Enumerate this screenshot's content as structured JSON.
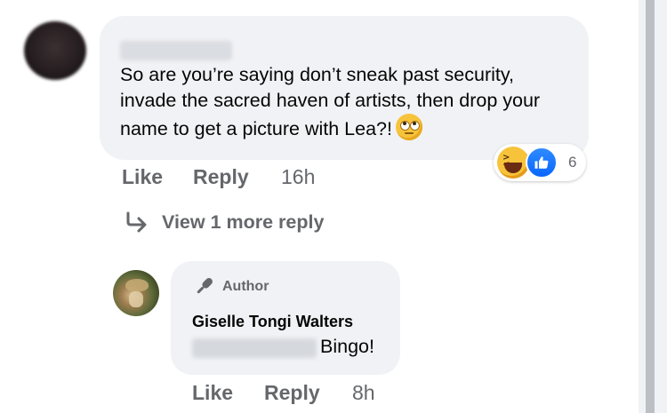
{
  "comment": {
    "author_name": "",
    "text": "So are you’re saying don’t sneak past security, invade the sacred haven of artists, then drop your name to get a picture with Lea?!",
    "emoji": "face-with-rolling-eyes",
    "reaction_icons": [
      "haha-reaction-icon",
      "like-reaction-icon"
    ],
    "reaction_count": "6",
    "actions": {
      "like": "Like",
      "reply": "Reply",
      "time": "16h"
    },
    "view_more_replies": "View 1 more reply"
  },
  "reply": {
    "badge": "Author",
    "author_name": "Giselle Tongi Walters",
    "text": "Bingo!",
    "actions": {
      "like": "Like",
      "reply": "Reply",
      "time": "8h"
    }
  },
  "colors": {
    "bubble": "#f0f2f5",
    "secondary_text": "#65676b",
    "primary_text": "#050505",
    "like_blue": "#0866ff"
  }
}
